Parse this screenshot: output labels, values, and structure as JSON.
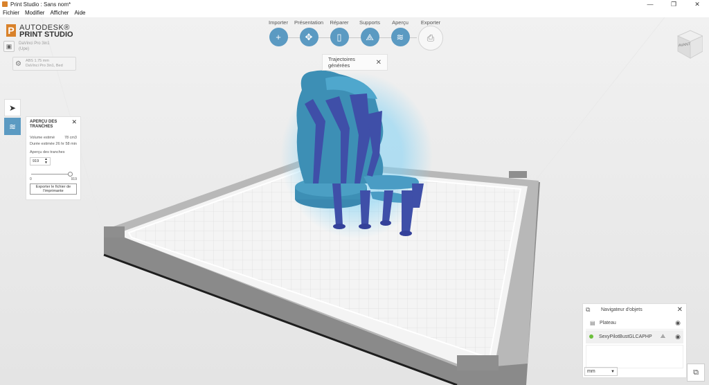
{
  "window": {
    "title": "Print Studio : Sans nom*",
    "min_glyph": "—",
    "max_glyph": "❐",
    "close_glyph": "✕"
  },
  "menu": [
    "Fichier",
    "Modifier",
    "Afficher",
    "Aide"
  ],
  "logo": {
    "line1": "AUTODESK®",
    "line2": "PRINT STUDIO"
  },
  "printer": {
    "name": "DaVinci Pro 3in1",
    "mode": "(Upe)"
  },
  "material": {
    "name": "ABS 1.75 mm",
    "printer": "DaVinci Pro 3in1, Bed"
  },
  "toolbar": {
    "items": [
      {
        "label": "Importer",
        "icon": "+"
      },
      {
        "label": "Présentation",
        "icon": "✥"
      },
      {
        "label": "Réparer",
        "icon": "▯"
      },
      {
        "label": "Supports",
        "icon": "⟁"
      },
      {
        "label": "Aperçu",
        "icon": "≋"
      },
      {
        "label": "Exporter",
        "icon": "⎙"
      }
    ]
  },
  "toast": {
    "text": "Trajectoires générées",
    "close": "✕"
  },
  "viewcube": {
    "label": "AVANT"
  },
  "left_tools": {
    "select_icon": "➤",
    "layers_icon": "≋"
  },
  "slice_panel": {
    "title": "APERÇU DES TRANCHES",
    "close": "✕",
    "volume_label": "Volume estimé",
    "volume_value": "78 cm3",
    "duration_label": "Durée estimée",
    "duration_value": "26 hr 58 min",
    "preview_label": "Aperçu des tranches",
    "slice_value": "919",
    "range_min": "0",
    "range_max": "919",
    "slider_position": 1.0,
    "export_label": "Exporter le fichier de l'imprimante"
  },
  "navigator": {
    "title": "Navigateur d'objets",
    "close": "✕",
    "items": [
      {
        "label": "Plateau"
      },
      {
        "label": "SexyPilotBustGLCAPHP"
      }
    ],
    "unit": "mm"
  },
  "colors": {
    "accent": "#5b9ac2",
    "model": "#3d8fb5",
    "supports": "#3f4fa8",
    "status_ok": "#6cbf3c"
  }
}
